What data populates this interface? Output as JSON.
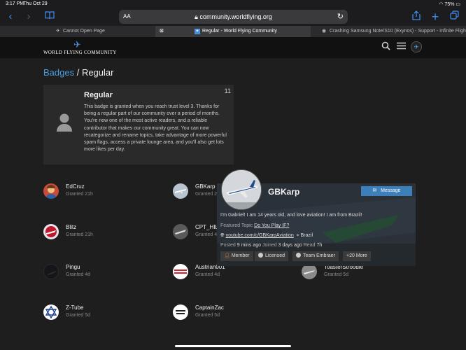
{
  "status": {
    "time": "3:17 PM",
    "date": "Thu Oct 29",
    "battery": "75%"
  },
  "browser": {
    "url": "community.worldflying.org",
    "aa_label": "AA",
    "tabs": [
      {
        "label": "Cannot Open Page",
        "active": false
      },
      {
        "label": "Regular - World Flying Community",
        "active": true
      },
      {
        "label": "Crashing Samsung Note/S10 (Exynos) - Support - Infinite Flight...",
        "active": false
      }
    ]
  },
  "header": {
    "logo_text": "WORLD FLYING COMMUNITY"
  },
  "breadcrumb": {
    "parent": "Badges",
    "separator": " / ",
    "current": "Regular"
  },
  "badge": {
    "title": "Regular",
    "count": "11",
    "description": "This badge is granted when you reach trust level 3. Thanks for being a regular part of our community over a period of months. You're now one of the most active readers, and a reliable contributor that makes our community great. You can now recategorize and rename topics, take advantage of more powerful spam flags, access a private lounge area, and you'll also get lots more likes per day."
  },
  "grantees": [
    {
      "name": "EdCruz",
      "granted": "Granted 21h"
    },
    {
      "name": "GBKarp",
      "granted": "Granted 21h"
    },
    {
      "name": "Blitz",
      "granted": "Granted 21h"
    },
    {
      "name": "CPT_HILL",
      "granted": "Granted 4"
    },
    {
      "name": "Pingu",
      "granted": "Granted 4d"
    },
    {
      "name": "Austrian001",
      "granted": "Granted 4d"
    },
    {
      "name": "ToasterStroodie",
      "granted": "Granted 5d"
    },
    {
      "name": "Z-Tube",
      "granted": "Granted 5d"
    },
    {
      "name": "CaptainZac",
      "granted": "Granted 5d"
    }
  ],
  "user_card": {
    "username": "GBKarp",
    "message_label": "Message",
    "bio": "I'm Gabriel! I am 14 years old, and love aviation! I am from Brazil!",
    "featured_label": "Featured Topic",
    "featured_topic": "Do You Play IF?",
    "website": "youtube.com/c/GBKarpAviation",
    "location": "Brazil",
    "posted_label": "Posted",
    "posted_value": "9 mins ago",
    "joined_label": "Joined",
    "joined_value": "3 days ago",
    "read_label": "Read",
    "read_value": "7h",
    "chips": [
      "Member",
      "Licensed",
      "Team Embraer",
      "+20 More"
    ]
  }
}
